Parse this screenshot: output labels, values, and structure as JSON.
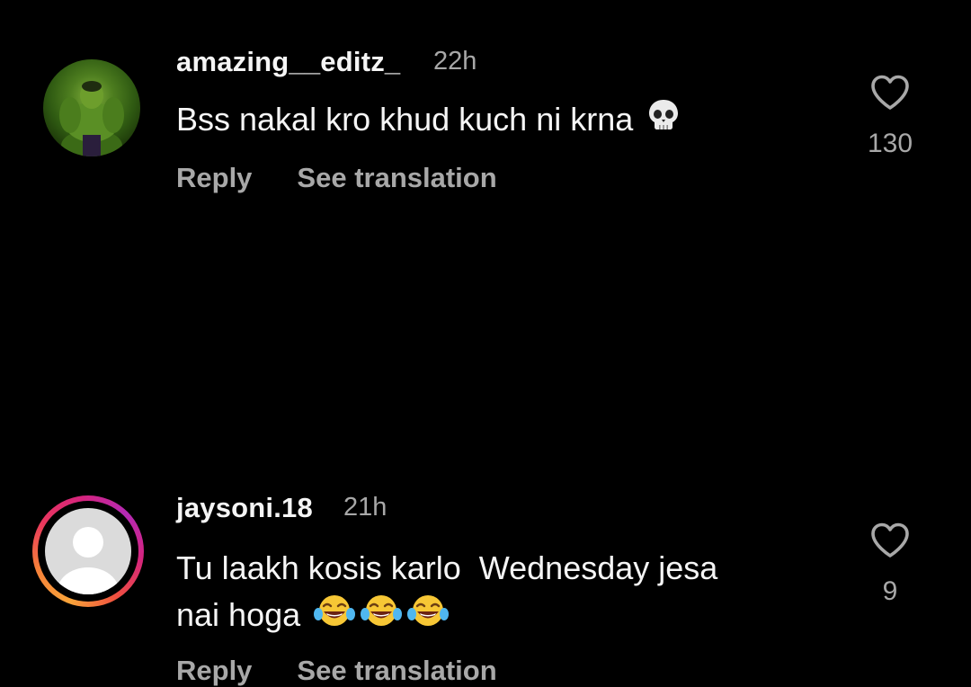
{
  "comments": [
    {
      "username": "amazing__editz_",
      "time": "22h",
      "text": "Bss nakal kro khud kuch ni krna",
      "emoji": [
        "skull-emoji"
      ],
      "reply_label": "Reply",
      "translate_label": "See translation",
      "likes": "130",
      "avatar": "hulk-avatar"
    },
    {
      "username": "jaysoni.18",
      "time": "21h",
      "text_line1": "Tu laakh kosis karlo  Wednesday jesa",
      "text_line2": "nai hoga",
      "emoji": [
        "tears-of-joy-emoji",
        "tears-of-joy-emoji",
        "tears-of-joy-emoji"
      ],
      "reply_label": "Reply",
      "translate_label": "See translation",
      "likes": "9",
      "avatar": "default-avatar-with-story-ring"
    }
  ],
  "colors": {
    "background": "#000000",
    "primary_text": "#f5f5f5",
    "secondary_text": "#a8a8a8"
  }
}
